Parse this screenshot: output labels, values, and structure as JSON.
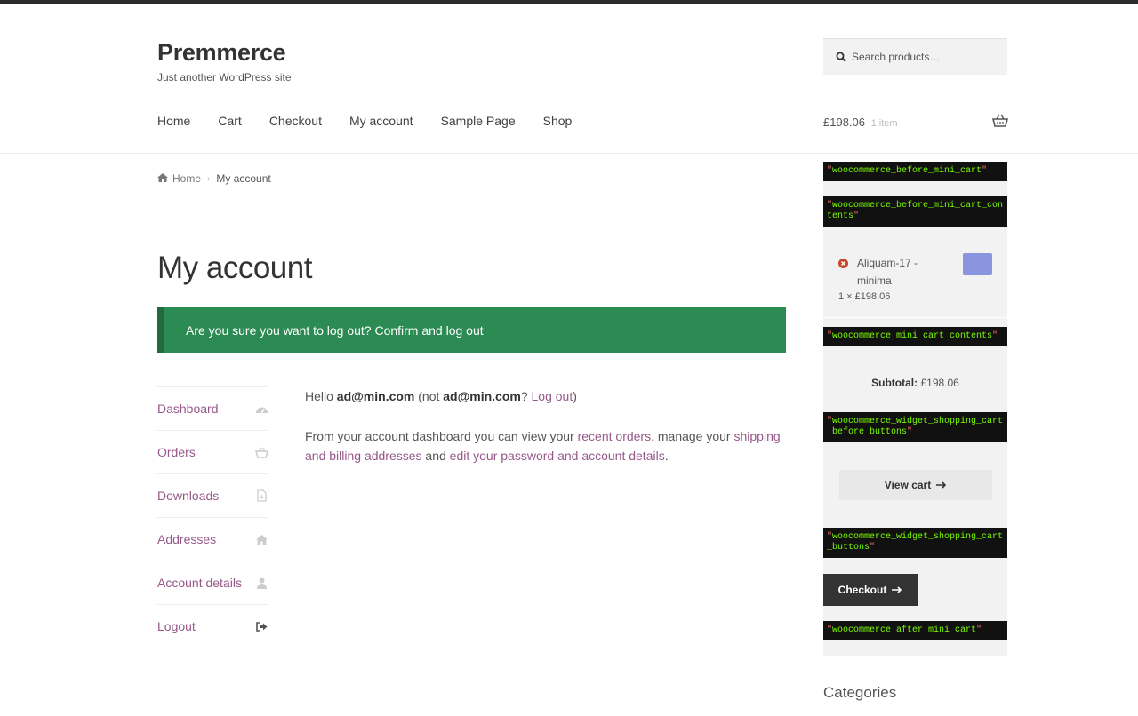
{
  "site": {
    "title": "Premmerce",
    "tagline": "Just another WordPress site"
  },
  "nav": {
    "items": [
      "Home",
      "Cart",
      "Checkout",
      "My account",
      "Sample Page",
      "Shop"
    ]
  },
  "search": {
    "placeholder": "Search products…"
  },
  "header_cart": {
    "total": "£198.06",
    "count": "1 item"
  },
  "breadcrumb": {
    "home": "Home",
    "current": "My account"
  },
  "page_title": "My account",
  "notice": {
    "text": "Are you sure you want to log out? Confirm and log out",
    "bg_color": "#2c8a53"
  },
  "account_nav": {
    "items": [
      {
        "label": "Dashboard",
        "icon": "dashboard-icon"
      },
      {
        "label": "Orders",
        "icon": "basket-icon"
      },
      {
        "label": "Downloads",
        "icon": "file-download-icon"
      },
      {
        "label": "Addresses",
        "icon": "home-icon"
      },
      {
        "label": "Account details",
        "icon": "user-icon"
      },
      {
        "label": "Logout",
        "icon": "sign-out-icon"
      }
    ]
  },
  "dashboard": {
    "hello_prefix": "Hello ",
    "user": "ad@min.com",
    "not_prefix": " (not ",
    "not_user": "ad@min.com",
    "q": "? ",
    "logout_link": "Log out",
    "close": ")",
    "p1": "From your account dashboard you can view your ",
    "recent_orders": "recent orders",
    "p2": ", manage your ",
    "addresses_link": "shipping and billing addresses",
    "p3": " and ",
    "account_link": "edit your password and account details",
    "p4": "."
  },
  "mini_cart": {
    "hooks": {
      "before_mini_cart": "woocommerce_before_mini_cart",
      "before_contents": "woocommerce_before_mini_cart_contents",
      "contents": "woocommerce_mini_cart_contents",
      "before_buttons": "woocommerce_widget_shopping_cart_before_buttons",
      "buttons": "woocommerce_widget_shopping_cart_buttons",
      "after_mini_cart": "woocommerce_after_mini_cart"
    },
    "item": {
      "name": "Aliquam-17 - minima",
      "quantity": "1 × £198.06"
    },
    "subtotal_label": "Subtotal:",
    "subtotal_value": "£198.06",
    "view_cart": "View cart",
    "checkout": "Checkout"
  },
  "categories_title": "Categories"
}
